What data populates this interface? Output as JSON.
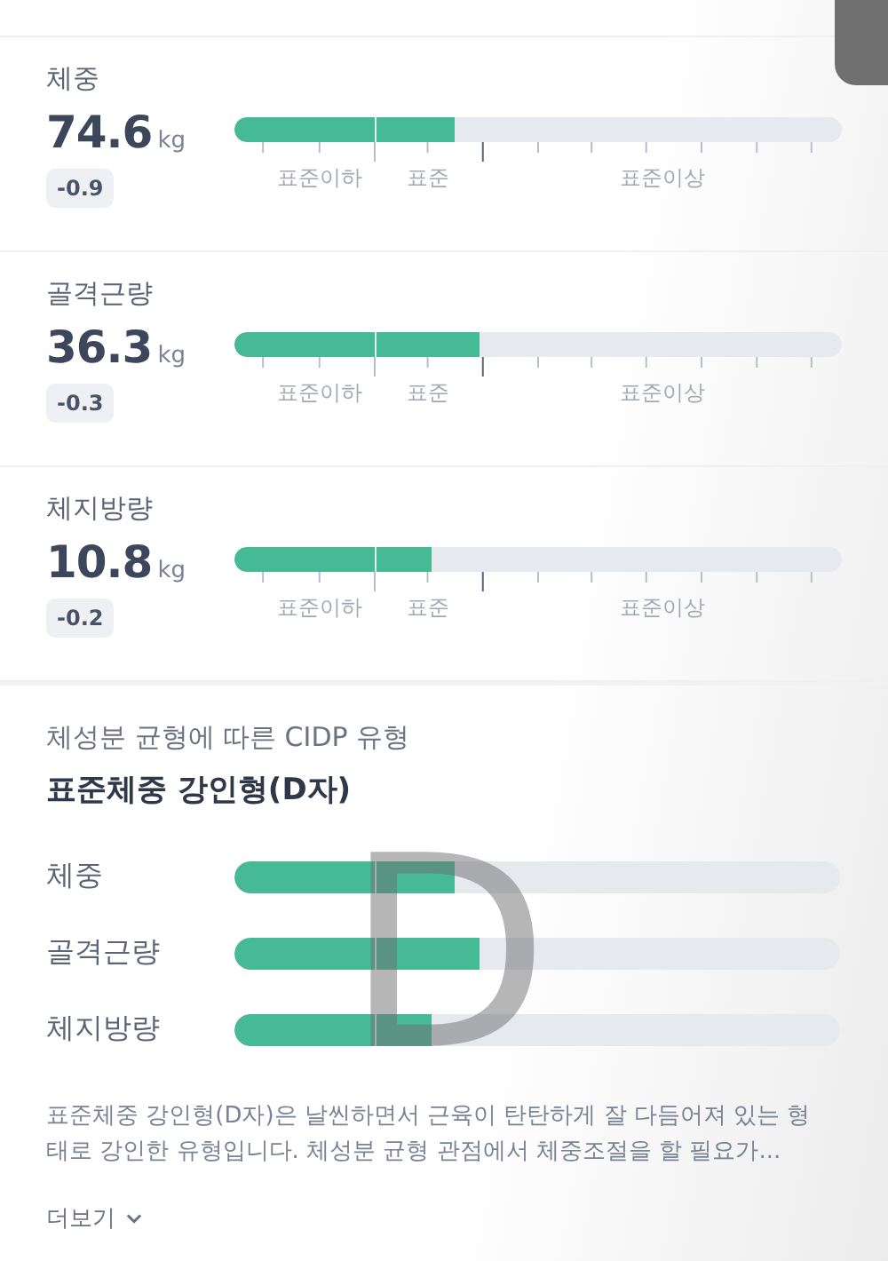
{
  "metrics": [
    {
      "name": "체중",
      "value": "74.6",
      "unit": "kg",
      "change": "-0.9",
      "level": 0.363,
      "scale": [
        "표준이하",
        "표준",
        "표준이상"
      ]
    },
    {
      "name": "골격근량",
      "value": "36.3",
      "unit": "kg",
      "change": "-0.3",
      "level": 0.404,
      "scale": [
        "표준이하",
        "표준",
        "표준이상"
      ]
    },
    {
      "name": "체지방량",
      "value": "10.8",
      "unit": "kg",
      "change": "-0.2",
      "level": 0.325,
      "scale": [
        "표준이하",
        "표준",
        "표준이상"
      ]
    }
  ],
  "cidp": {
    "title": "체성분 균형에 따른 CIDP 유형",
    "type_name": "표준체중 강인형(D자)",
    "letter": "D",
    "bars": [
      {
        "name": "체중",
        "level": 0.363
      },
      {
        "name": "골격근량",
        "level": 0.404
      },
      {
        "name": "체지방량",
        "level": 0.325
      }
    ],
    "description": "표준체중 강인형(D자)은 날씬하면서 근육이 탄탄하게 잘 다듬어져 있는 형태로 강인한 유형입니다. 체성분 균형 관점에서 체중조절을 할 필요가...",
    "more": "더보기"
  }
}
